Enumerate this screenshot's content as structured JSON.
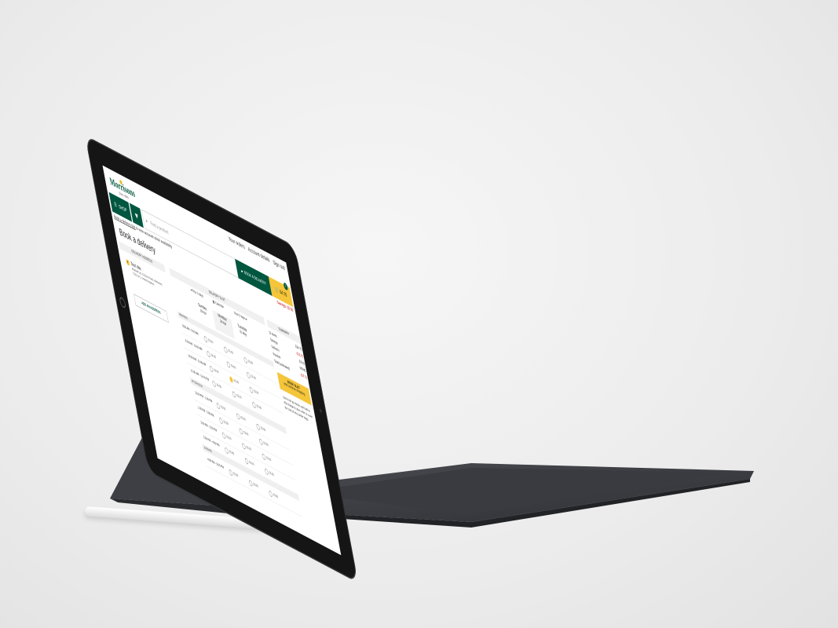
{
  "colors": {
    "brand_green": "#00563f",
    "accent_yellow": "#f5c53a",
    "sale_red": "#cc0000"
  },
  "top_links": [
    "Your orders",
    "Account details",
    "Sign out"
  ],
  "logo": {
    "name": "Morrisons",
    "tagline": "Since 1899"
  },
  "nav": {
    "shop_label": "SHOP",
    "search_placeholder": "Find a product",
    "book_delivery_label": "BOOK A DELIVERY",
    "trolley_total": "£4.70",
    "trolley_count": "1",
    "savings": "Savings: £0.00"
  },
  "stock_note": {
    "link": "Book a delivery slot",
    "rest": " to view accurate stock availability"
  },
  "page_title": "Book a delivery",
  "delivery_address": {
    "header": "DELIVERY ADDRESS",
    "name": "Test site",
    "lines": "Bluebell Ltd, 33 Bore Road, Hartlepool, TS25 1PL, United Kingdom",
    "add_button": "ADD AN ADDRESS"
  },
  "delivery_slot": {
    "header": "DELIVERY SLOT",
    "prev": "◂ Prev 3 days",
    "calendar": "Calendar",
    "next": "Next 3 days ▸",
    "days": [
      {
        "name": "Sunday",
        "date": "29 Apr"
      },
      {
        "name": "Monday",
        "date": "30 Apr"
      },
      {
        "name": "Tuesday",
        "date": "01 May"
      }
    ],
    "periods": [
      {
        "label": "MORNING",
        "rows": [
          {
            "time": "8:00 AM - 9:00 AM",
            "prices": [
              "£3.00",
              "£3.00",
              "£3.00"
            ]
          },
          {
            "time": "9:00 AM - 10:00 AM",
            "prices": [
              "£4.00",
              "£3.00",
              "£3.00"
            ]
          },
          {
            "time": "10:00 AM - 11:00 AM",
            "prices": [
              "£4.00",
              "£3.00",
              "£3.00"
            ]
          },
          {
            "time": "11:00 AM - 12:00 PM",
            "prices": [
              "£4.50",
              "£3.00",
              "£3.00"
            ]
          }
        ]
      },
      {
        "label": "AFTERNOON",
        "rows": [
          {
            "time": "12:00 PM - 1:00 PM",
            "prices": [
              "£3.00",
              "£3.00",
              "£3.00"
            ]
          },
          {
            "time": "1:00 PM - 2:00 PM",
            "prices": [
              "£3.50",
              "£3.00",
              "£3.00"
            ]
          },
          {
            "time": "2:00 PM - 3:00 PM",
            "prices": [
              "£3.00",
              "£3.00",
              "£3.00"
            ]
          },
          {
            "time": "3:00 PM - 4:00 PM",
            "prices": [
              "£3.00",
              "£3.00",
              "£3.00"
            ]
          }
        ]
      },
      {
        "label": "EVENING",
        "rows": [
          {
            "time": "4:00 PM - 5:00 PM",
            "prices": [
              "£3.00",
              "£3.00",
              "£3.00"
            ]
          }
        ]
      }
    ],
    "selected": {
      "period": 0,
      "row": 2,
      "day": 1
    }
  },
  "summary": {
    "header": "SUMMARY",
    "rows": [
      {
        "label": "12 items",
        "value": "£34.70",
        "red": false
      },
      {
        "label": "Savings",
        "value": "-£22.75",
        "red": true
      },
      {
        "label": "Delivery",
        "value": "£3.00",
        "red": false
      },
      {
        "label": "Voucher",
        "value": "NONE",
        "red": false
      },
      {
        "label": "Total (estimated)",
        "value": "£37.70",
        "red": true
      }
    ],
    "book_button": "BOOK SLOT",
    "book_sub": "and continue shopping",
    "note": "Just to let you know, we'll add a 40p charge to your order to cover the cost of any carrier bags."
  }
}
